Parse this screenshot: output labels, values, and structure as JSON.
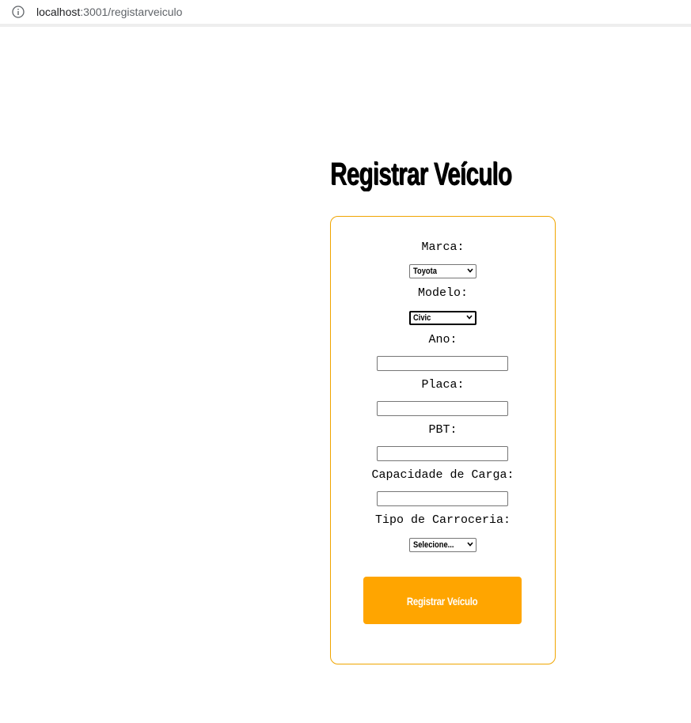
{
  "browser": {
    "url_host": "localhost",
    "url_path": ":3001/registarveiculo"
  },
  "page": {
    "title": "Registrar Veículo"
  },
  "form": {
    "marca": {
      "label": "Marca:",
      "value": "Toyota"
    },
    "modelo": {
      "label": "Modelo:",
      "value": "Civic"
    },
    "ano": {
      "label": "Ano:",
      "value": ""
    },
    "placa": {
      "label": "Placa:",
      "value": ""
    },
    "pbt": {
      "label": "PBT:",
      "value": ""
    },
    "capacidade": {
      "label": "Capacidade de Carga:",
      "value": ""
    },
    "carroceria": {
      "label": "Tipo de Carroceria:",
      "value": "Selecione..."
    },
    "submit_label": "Registrar Veículo"
  },
  "colors": {
    "accent": "#ffa500",
    "card_border": "#f0a500",
    "button_text": "#ffffff"
  },
  "icons": {
    "address_bar": "info-icon",
    "select": "chevron-down-icon"
  }
}
